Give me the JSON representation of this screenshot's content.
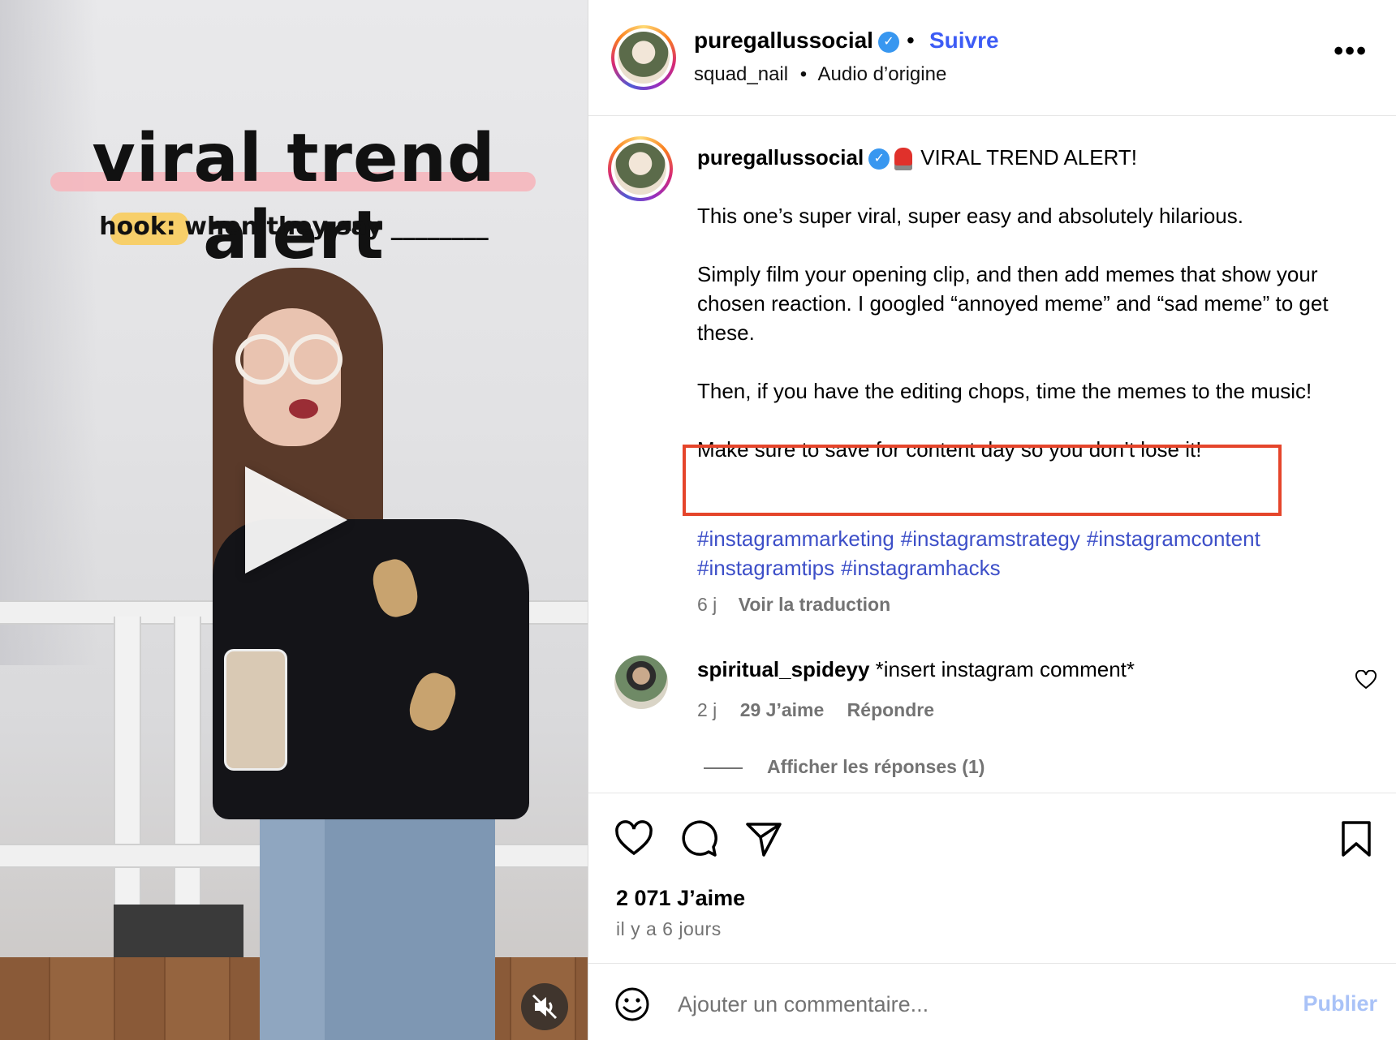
{
  "video": {
    "overlay_title": "viral trend alert",
    "hook_line": "hook: when they say ________"
  },
  "header": {
    "username": "puregallussocial",
    "follow_label": "Suivre",
    "dot": "•",
    "audio_user": "squad_nail",
    "audio_label": "Audio d’origine",
    "more": "•••"
  },
  "caption": {
    "username": "puregallussocial",
    "headline": "VIRAL TREND ALERT!",
    "paragraphs": [
      "This one’s super viral, super easy and absolutely hilarious.",
      "Simply film your opening clip, and then add memes that show your chosen reaction. I googled “annoyed meme” and “sad meme” to get these.",
      "Then, if you have the editing chops, time the memes to the music!",
      "Make sure to save for content day so you don’t lose it!"
    ],
    "hashtags": [
      "#instagrammarketing",
      "#instagramstrategy",
      "#instagramcontent",
      "#instagramtips",
      "#instagramhacks"
    ],
    "age": "6 j",
    "translate_label": "Voir la traduction"
  },
  "comment": {
    "username": "spiritual_spideyy",
    "text": "*insert instagram comment*",
    "age": "2 j",
    "likes": "29 J’aime",
    "reply_label": "Répondre",
    "view_replies": "Afficher les réponses (1)"
  },
  "actions": {
    "likes_count": "2 071 J’aime",
    "posted": "il y a 6 jours"
  },
  "comment_bar": {
    "placeholder": "Ajouter un commentaire...",
    "publish_label": "Publier"
  },
  "colors": {
    "link_blue": "#3d5cf5",
    "hashtag_blue": "#3d4fc8",
    "highlight_red": "#e5452b",
    "muted_gray": "#737373",
    "publish_disabled": "#a9c2f7"
  },
  "icons": [
    "play-icon",
    "mute-icon",
    "verified-icon",
    "more-icon",
    "heart-icon",
    "comment-icon",
    "share-icon",
    "bookmark-icon",
    "emoji-icon",
    "siren-emoji"
  ]
}
